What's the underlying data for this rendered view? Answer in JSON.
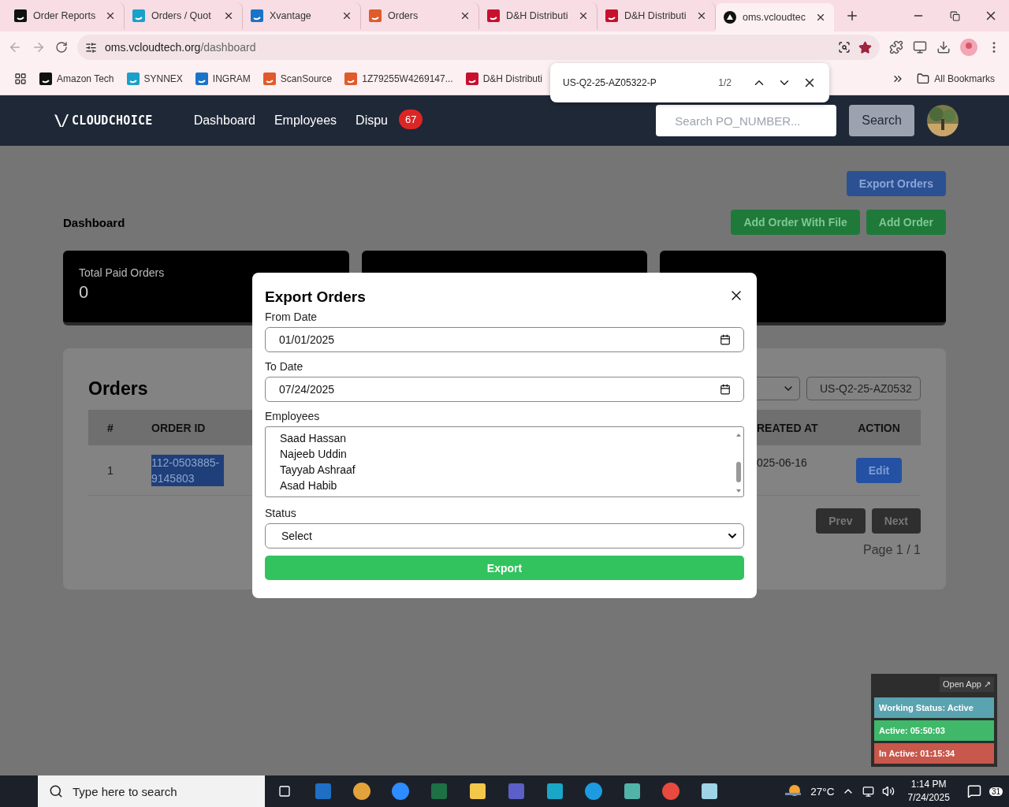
{
  "browser": {
    "tabs": [
      {
        "title": "Order Reports",
        "selected": false
      },
      {
        "title": "Orders / Quot",
        "selected": false
      },
      {
        "title": "Xvantage",
        "selected": false
      },
      {
        "title": "Orders",
        "selected": false
      },
      {
        "title": "D&H Distributi",
        "selected": false
      },
      {
        "title": "D&H Distributi",
        "selected": false
      },
      {
        "title": "oms.vcloudtec",
        "selected": true
      }
    ],
    "url_host": "oms.vcloudtech.org",
    "url_path": "/dashboard",
    "bookmarks": [
      "Amazon Tech",
      "SYNNEX",
      "INGRAM",
      "ScanSource",
      "1Z79255W4269147...",
      "D&H Distributi"
    ],
    "all_bookmarks": "All Bookmarks",
    "find_bar": {
      "query": "US-Q2-25-AZ05322-P",
      "count": "1/2"
    }
  },
  "header": {
    "logo": "CLOUDCHOICE",
    "nav": [
      "Dashboard",
      "Employees",
      "Dispu"
    ],
    "badge": "67",
    "search_placeholder": "Search PO_NUMBER...",
    "search_button": "Search"
  },
  "page": {
    "export_button": "Export Orders",
    "title": "Dashboard",
    "add_file_button": "Add Order With File",
    "add_button": "Add Order",
    "cards": [
      {
        "kind": "stat",
        "label": "Total Paid Orders",
        "value": "0"
      },
      {
        "kind": "covered"
      },
      {
        "kind": "covered"
      }
    ],
    "orders": {
      "title": "Orders",
      "search_value": "US-Q2-25-AZ0532",
      "columns": [
        "#",
        "ORDER ID",
        "REATED AT",
        "ACTION"
      ],
      "rows": [
        {
          "index": "1",
          "order_id": "112-0503885-9145803",
          "created_at": "025-06-16",
          "action": "Edit"
        }
      ],
      "prev": "Prev",
      "next": "Next",
      "page_info": "Page 1 / 1"
    }
  },
  "modal": {
    "title": "Export Orders",
    "from_label": "From Date",
    "from_value": "01/01/2025",
    "to_label": "To Date",
    "to_value": "07/24/2025",
    "employees_label": "Employees",
    "employees": [
      "Saad Hassan",
      "Najeeb Uddin",
      "Tayyab Ashraaf",
      "Asad Habib"
    ],
    "status_label": "Status",
    "status_value": "Select",
    "export_button": "Export"
  },
  "widget": {
    "open_app": "Open App ↗",
    "rows": [
      {
        "text": "Working Status: Active",
        "color": "#5aa3b0"
      },
      {
        "text": "Active: 05:50:03",
        "color": "#3fb86a"
      },
      {
        "text": "In Active: 01:15:34",
        "color": "#c8574c"
      }
    ]
  },
  "taskbar": {
    "search": "Type here to search",
    "weather": "27°C",
    "time": "1:14 PM",
    "date": "7/24/2025",
    "notifications": "31"
  }
}
